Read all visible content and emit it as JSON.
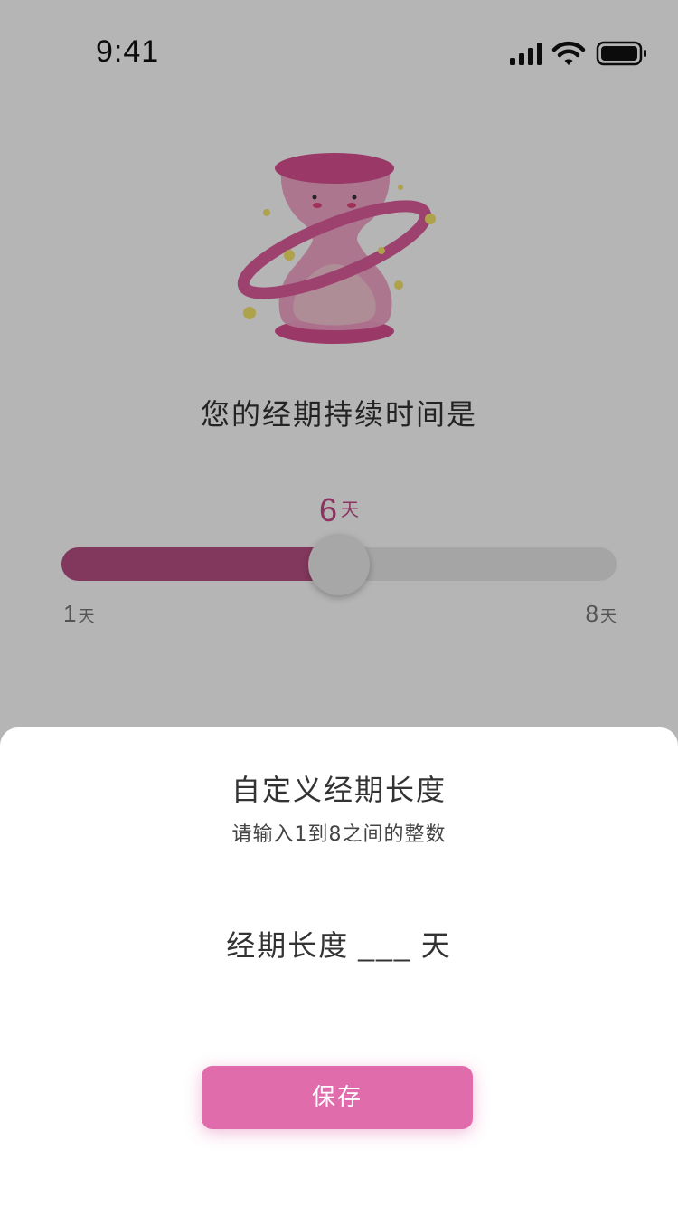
{
  "status_bar": {
    "time": "9:41"
  },
  "main": {
    "question": "您的经期持续时间是",
    "slider": {
      "value": "6",
      "unit": "天",
      "min_value": "1",
      "min_unit": "天",
      "max_value": "8",
      "max_unit": "天",
      "fill_fraction": 0.5
    },
    "colors": {
      "accent": "#b84f83",
      "value_text": "#c44a86"
    }
  },
  "sheet": {
    "title": "自定义经期长度",
    "subtitle": "请输入1到8之间的整数",
    "input_label": "经期长度",
    "input_blank": "___",
    "input_unit": "天",
    "save_label": "保存",
    "button_color": "#e06cac"
  }
}
